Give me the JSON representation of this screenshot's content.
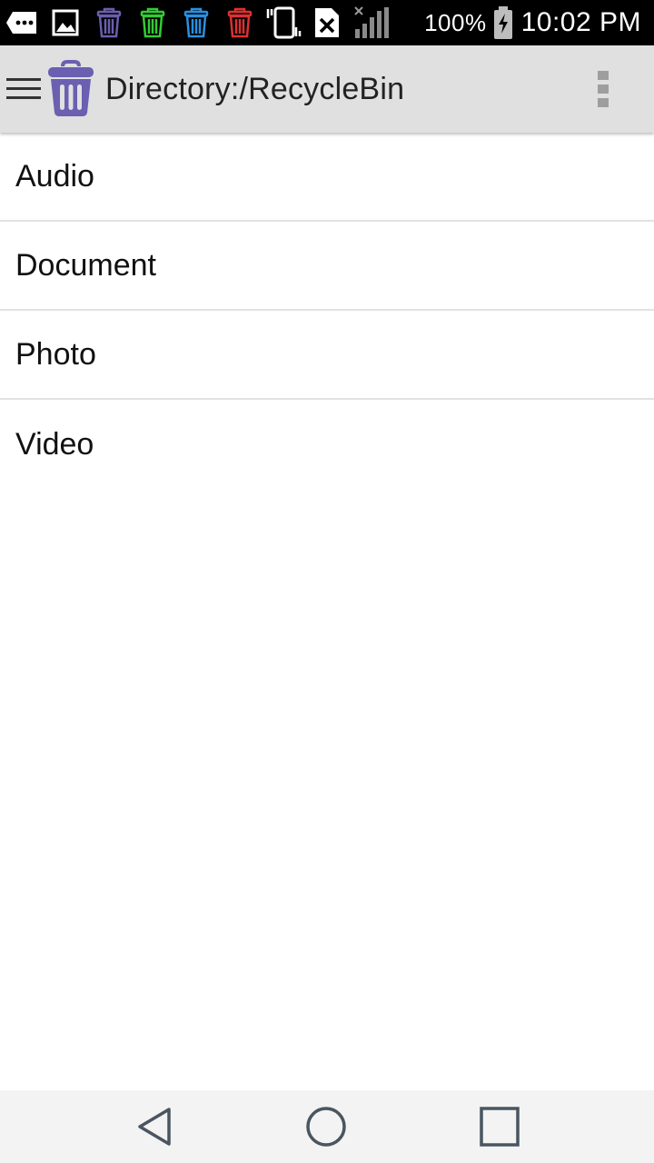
{
  "status_bar": {
    "battery_percent": "100%",
    "time": "10:02 PM",
    "icons": [
      "message-icon",
      "image-icon",
      "trash-purple-icon",
      "trash-green-icon",
      "trash-blue-icon",
      "trash-red-icon",
      "vibrate-icon",
      "no-sim-icon",
      "signal-icon",
      "battery-icon"
    ]
  },
  "app_bar": {
    "title": "Directory:/RecycleBin",
    "logo_color": "#6a5fb0"
  },
  "list": {
    "items": [
      {
        "label": "Audio"
      },
      {
        "label": "Document"
      },
      {
        "label": "Photo"
      },
      {
        "label": "Video"
      }
    ]
  },
  "nav_bar": {
    "buttons": [
      "back",
      "home",
      "recents"
    ]
  },
  "colors": {
    "status_bar_bg": "#000000",
    "app_bar_bg": "#e0e0e0",
    "trash_purple": "#6a5fb0",
    "trash_green": "#33cc33",
    "trash_blue": "#2a8fe0",
    "trash_red": "#e03030"
  }
}
